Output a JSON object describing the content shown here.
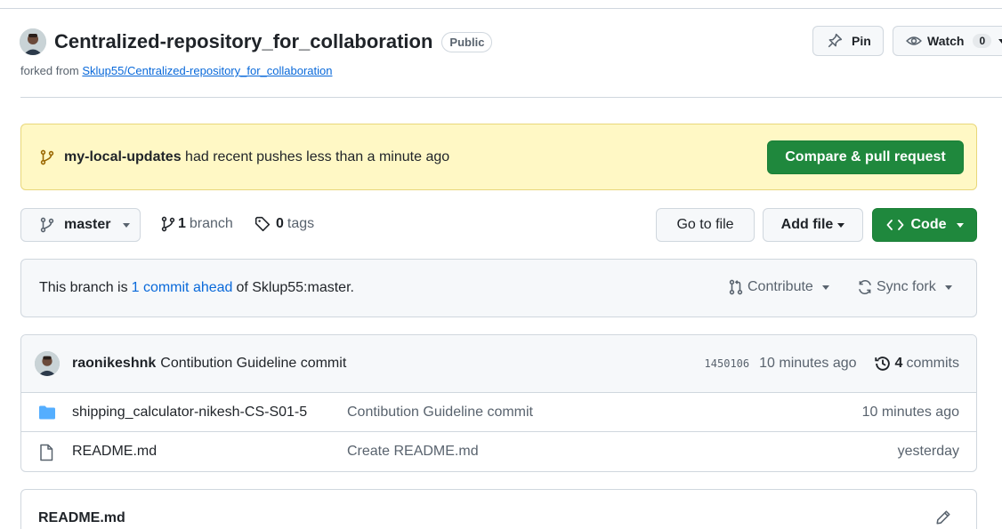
{
  "repo": {
    "name": "Centralized-repository_for_collaboration",
    "visibility": "Public",
    "forked_prefix": "forked from",
    "forked_from": "Sklup55/Centralized-repository_for_collaboration"
  },
  "header_actions": {
    "pin_label": "Pin",
    "watch_label": "Watch",
    "watch_count": "0"
  },
  "banner": {
    "branch": "my-local-updates",
    "text": "had recent pushes less than a minute ago",
    "compare_label": "Compare & pull request"
  },
  "toolbar": {
    "branch_label": "master",
    "branch_count": "1",
    "branch_word": "branch",
    "tag_count": "0",
    "tag_word": "tags",
    "go_to_file": "Go to file",
    "add_file": "Add file",
    "code": "Code"
  },
  "ahead": {
    "prefix": "This branch is",
    "link": "1 commit ahead",
    "suffix": "of Sklup55:master.",
    "contribute": "Contribute",
    "sync_fork": "Sync fork"
  },
  "latest_commit": {
    "author": "raonikeshnk",
    "message": "Contibution Guideline commit",
    "sha": "1450106",
    "time": "10 minutes ago",
    "commit_count": "4",
    "commit_word": "commits"
  },
  "files": [
    {
      "type": "folder",
      "name": "shipping_calculator-nikesh-CS-S01-5",
      "message": "Contibution Guideline commit",
      "time": "10 minutes ago"
    },
    {
      "type": "file",
      "name": "README.md",
      "message": "Create README.md",
      "time": "yesterday"
    }
  ],
  "readme": {
    "title": "README.md"
  },
  "colors": {
    "accent": "#0969da",
    "primary_button": "#1f883d",
    "banner_bg": "#fff8c5",
    "folder": "#54aeff"
  }
}
